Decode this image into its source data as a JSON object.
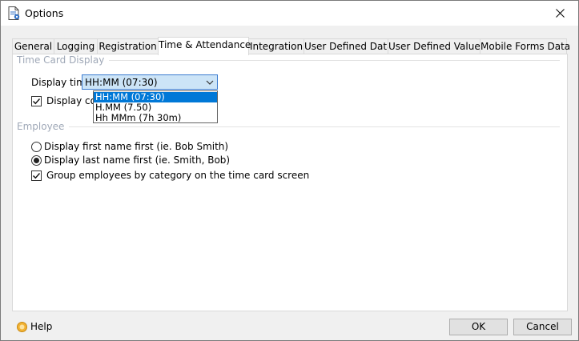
{
  "window": {
    "title": "Options"
  },
  "tabs": [
    {
      "label": "General",
      "active": false
    },
    {
      "label": "Logging",
      "active": false
    },
    {
      "label": "Registration",
      "active": false
    },
    {
      "label": "Time & Attendance",
      "active": true
    },
    {
      "label": "Integration",
      "active": false
    },
    {
      "label": "User Defined Data",
      "active": false
    },
    {
      "label": "User Defined Values",
      "active": false
    },
    {
      "label": "Mobile Forms Data",
      "active": false
    }
  ],
  "time_card_display": {
    "group_label": "Time Card Display",
    "display_time_label": "Display time:",
    "display_time_value": "HH:MM (07:30)",
    "options": [
      "HH:MM (07:30)",
      "H.MM (7.50)",
      "Hh MMm (7h 30m)"
    ],
    "checkbox_label_visible": "Display con",
    "checkbox_checked": true
  },
  "employee": {
    "group_label": "Employee",
    "radio_first": "Display first name first (ie. Bob Smith)",
    "radio_last": "Display last name first (ie. Smith, Bob)",
    "selected": "last",
    "group_checkbox": "Group employees by category on the time card screen",
    "group_checkbox_checked": true
  },
  "footer": {
    "help": "Help",
    "ok": "OK",
    "cancel": "Cancel"
  }
}
